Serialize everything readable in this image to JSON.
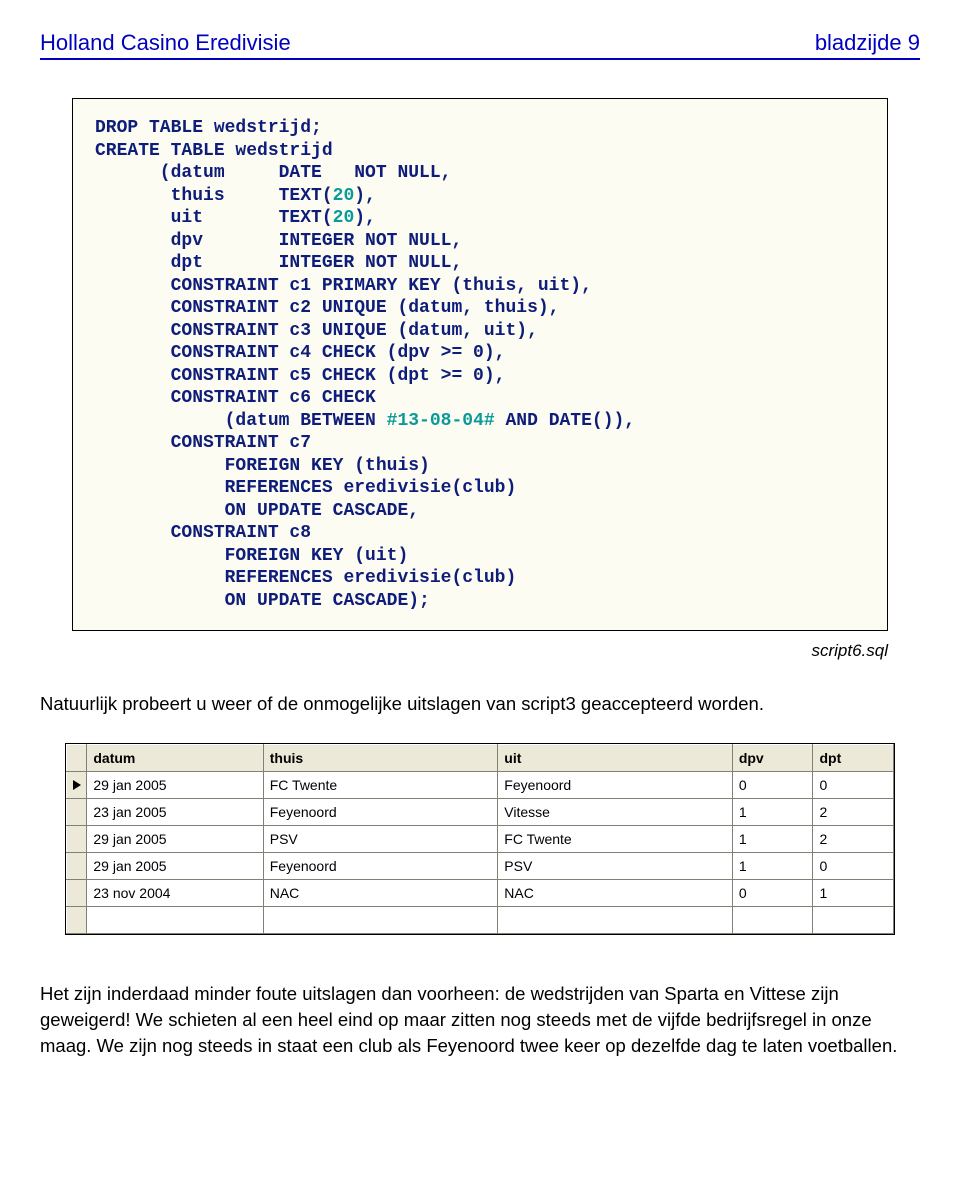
{
  "header": {
    "title": "Holland Casino Eredivisie",
    "pageinfo": "bladzijde 9"
  },
  "code": {
    "lines": [
      "DROP TABLE wedstrijd;",
      "CREATE TABLE wedstrijd",
      "      (datum     DATE   NOT NULL,",
      "       thuis     TEXT(20),",
      "       uit       TEXT(20),",
      "       dpv       INTEGER NOT NULL,",
      "       dpt       INTEGER NOT NULL,",
      "       CONSTRAINT c1 PRIMARY KEY (thuis, uit),",
      "       CONSTRAINT c2 UNIQUE (datum, thuis),",
      "       CONSTRAINT c3 UNIQUE (datum, uit),",
      "       CONSTRAINT c4 CHECK (dpv >= 0),",
      "       CONSTRAINT c5 CHECK (dpt >= 0),",
      "       CONSTRAINT c6 CHECK",
      "            (datum BETWEEN #13-08-04# AND DATE()),",
      "       CONSTRAINT c7",
      "            FOREIGN KEY (thuis)",
      "            REFERENCES eredivisie(club)",
      "            ON UPDATE CASCADE,",
      "       CONSTRAINT c8",
      "            FOREIGN KEY (uit)",
      "            REFERENCES eredivisie(club)",
      "            ON UPDATE CASCADE);"
    ],
    "highlights": {
      "3": [
        "20"
      ],
      "4": [
        "20"
      ],
      "13": [
        "#13-08-04#"
      ]
    }
  },
  "caption": "script6.sql",
  "para1": "Natuurlijk probeert u weer of de onmogelijke uitslagen van script3 geaccepteerd worden.",
  "table": {
    "columns": [
      "datum",
      "thuis",
      "uit",
      "dpv",
      "dpt"
    ],
    "rows": [
      {
        "current": true,
        "datum": "29 jan 2005",
        "thuis": "FC Twente",
        "uit": "Feyenoord",
        "dpv": "0",
        "dpt": "0"
      },
      {
        "current": false,
        "datum": "23 jan 2005",
        "thuis": "Feyenoord",
        "uit": "Vitesse",
        "dpv": "1",
        "dpt": "2"
      },
      {
        "current": false,
        "datum": "29 jan 2005",
        "thuis": "PSV",
        "uit": "FC Twente",
        "dpv": "1",
        "dpt": "2"
      },
      {
        "current": false,
        "datum": "29 jan 2005",
        "thuis": "Feyenoord",
        "uit": "PSV",
        "dpv": "1",
        "dpt": "0"
      },
      {
        "current": false,
        "datum": "23 nov 2004",
        "thuis": "NAC",
        "uit": "NAC",
        "dpv": "0",
        "dpt": "1"
      }
    ]
  },
  "para2": "Het zijn inderdaad minder foute uitslagen dan voorheen: de wedstrijden van Sparta en Vittese zijn geweigerd! We schieten al een heel eind op maar zitten nog steeds met de vijfde bedrijfsregel in onze maag. We zijn nog steeds in staat een club als Feyenoord twee keer op dezelfde dag te laten voetballen."
}
